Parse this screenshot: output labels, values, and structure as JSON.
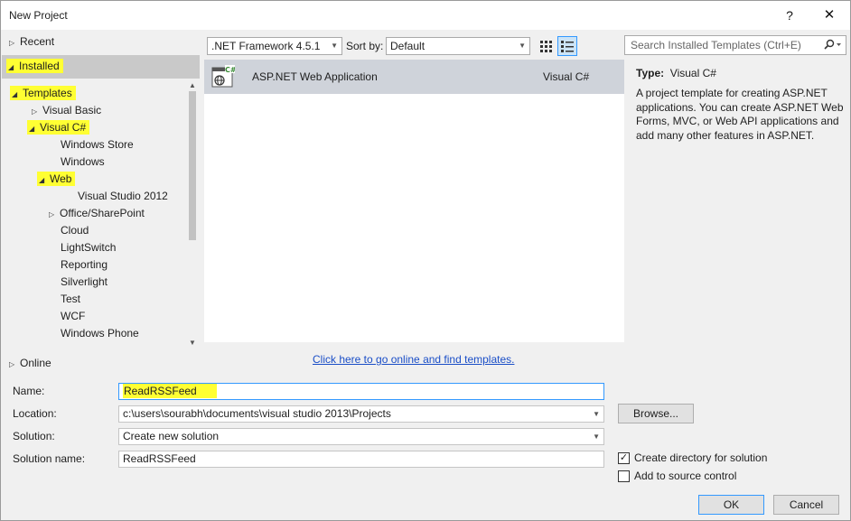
{
  "window": {
    "title": "New Project",
    "help_glyph": "?",
    "close_glyph": "✕"
  },
  "tree": {
    "recent": "Recent",
    "installed": "Installed",
    "templates": "Templates",
    "visual_basic": "Visual Basic",
    "visual_csharp": "Visual C#",
    "windows_store": "Windows Store",
    "windows": "Windows",
    "web": "Web",
    "visual_studio_2012": "Visual Studio 2012",
    "office_sharepoint": "Office/SharePoint",
    "cloud": "Cloud",
    "lightswitch": "LightSwitch",
    "reporting": "Reporting",
    "silverlight": "Silverlight",
    "test": "Test",
    "wcf": "WCF",
    "windows_phone": "Windows Phone",
    "online": "Online"
  },
  "toolbar": {
    "framework": ".NET Framework 4.5.1",
    "sort_by_label": "Sort by:",
    "sort_by_value": "Default",
    "search_placeholder": "Search Installed Templates (Ctrl+E)"
  },
  "templates": [
    {
      "name": "ASP.NET Web Application",
      "language": "Visual C#",
      "icon": "aspnet-web-app-icon"
    }
  ],
  "online_link": "Click here to go online and find templates.",
  "info": {
    "type_label": "Type:",
    "type_value": "Visual C#",
    "description": "A project template for creating ASP.NET applications. You can create ASP.NET Web Forms, MVC,  or Web API applications and add many other features in ASP.NET."
  },
  "form": {
    "name_label": "Name:",
    "name_value": "ReadRSSFeed",
    "location_label": "Location:",
    "location_value": "c:\\users\\sourabh\\documents\\visual studio 2013\\Projects",
    "solution_label": "Solution:",
    "solution_value": "Create new solution",
    "solution_name_label": "Solution name:",
    "solution_name_value": "ReadRSSFeed",
    "browse_label": "Browse...",
    "create_directory_label": "Create directory for solution",
    "create_directory_checked": true,
    "add_source_control_label": "Add to source control",
    "add_source_control_checked": false,
    "ok_label": "OK",
    "cancel_label": "Cancel"
  },
  "colors": {
    "highlight": "#ffff33",
    "selection": "#cfd3da",
    "link": "#1a4ec7",
    "accent": "#3399ff"
  }
}
